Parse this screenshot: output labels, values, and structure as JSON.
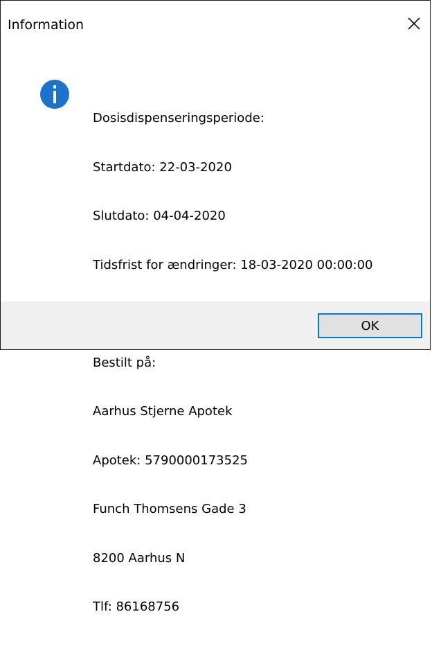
{
  "window": {
    "title": "Information",
    "close_icon": "close-icon"
  },
  "message": {
    "icon": "info-icon",
    "icon_color": "#1b74c9",
    "lines": [
      "Dosisdispenseringsperiode:",
      "Startdato: 22-03-2020",
      "Slutdato: 04-04-2020",
      "Tidsfrist for ændringer: 18-03-2020 00:00:00",
      "",
      "Bestilt på:",
      "Aarhus Stjerne Apotek",
      "Apotek: 5790000173525",
      "Funch Thomsens Gade 3",
      "8200 Aarhus N",
      "Tlf: 86168756"
    ]
  },
  "footer": {
    "ok_label": "OK",
    "accent": "#0078d7"
  }
}
